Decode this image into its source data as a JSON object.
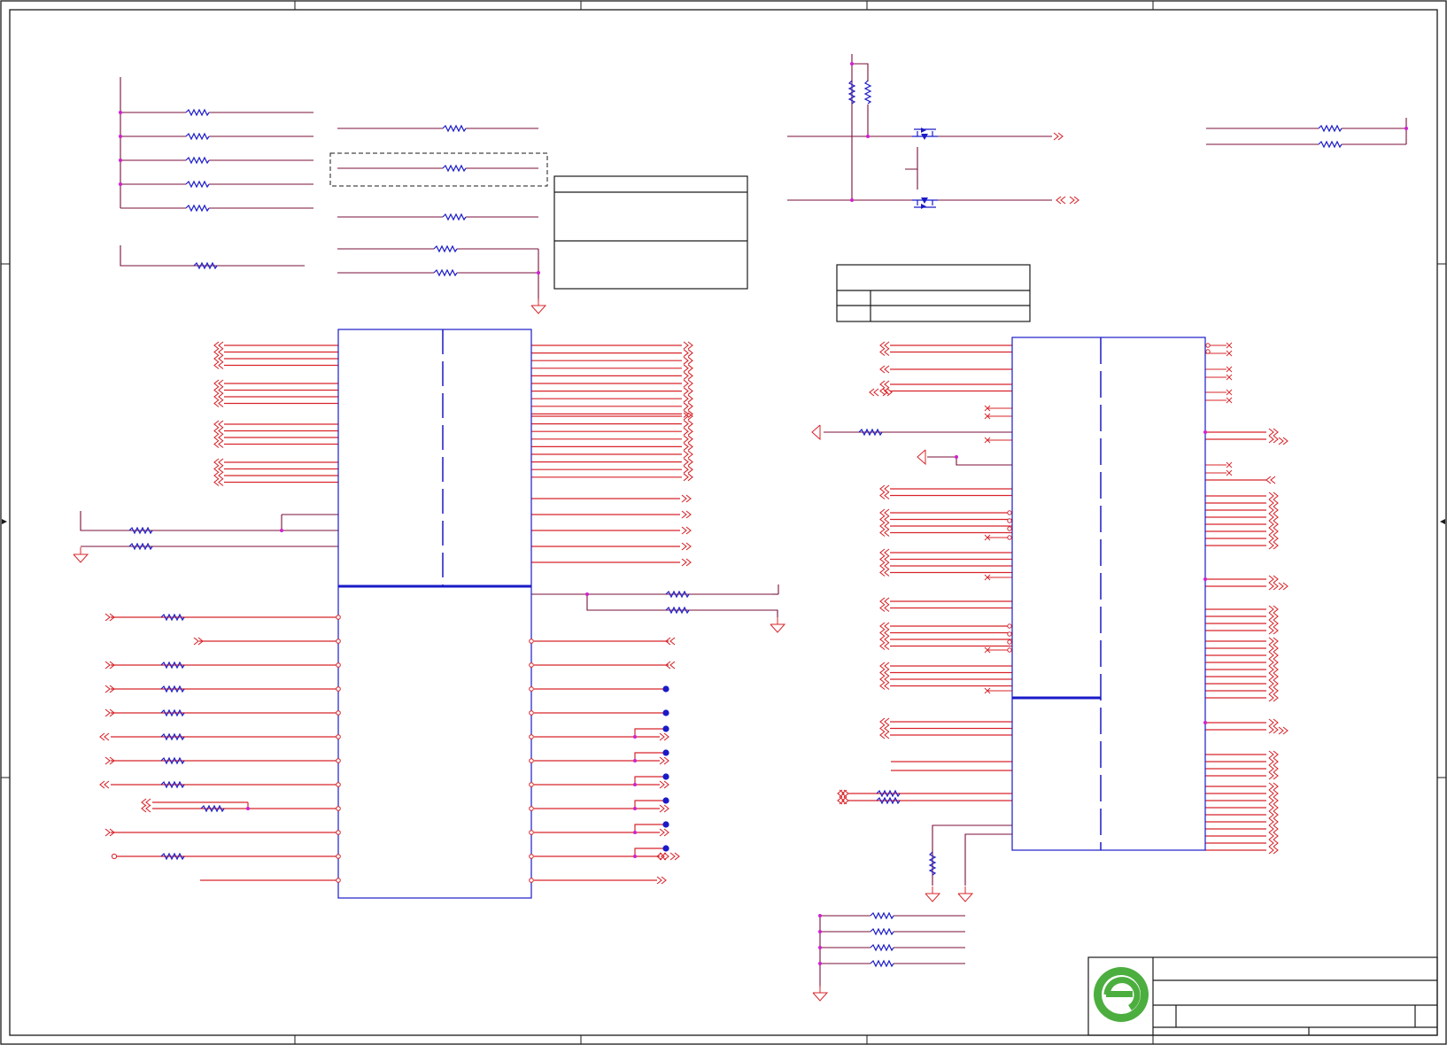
{
  "colors": {
    "border": "#1a1a1a",
    "wire": "#7a0f3a",
    "bus": "#d8242a",
    "component": "#1a1ac8",
    "junction": "#d020d0",
    "ground": "#d8242a",
    "logo": "#4cae3f"
  },
  "icons": {
    "logo": "green-e-logo-icon",
    "resistor": "resistor-icon",
    "offpage_connector": "offpage-connector-icon",
    "ground": "ground-icon",
    "power_port": "power-port-icon",
    "test_point": "test-point-icon",
    "mosfet": "mosfet-icon",
    "no_connect": "no-connect-icon"
  },
  "frame": {
    "zone_markers": 4,
    "title_block": true
  }
}
